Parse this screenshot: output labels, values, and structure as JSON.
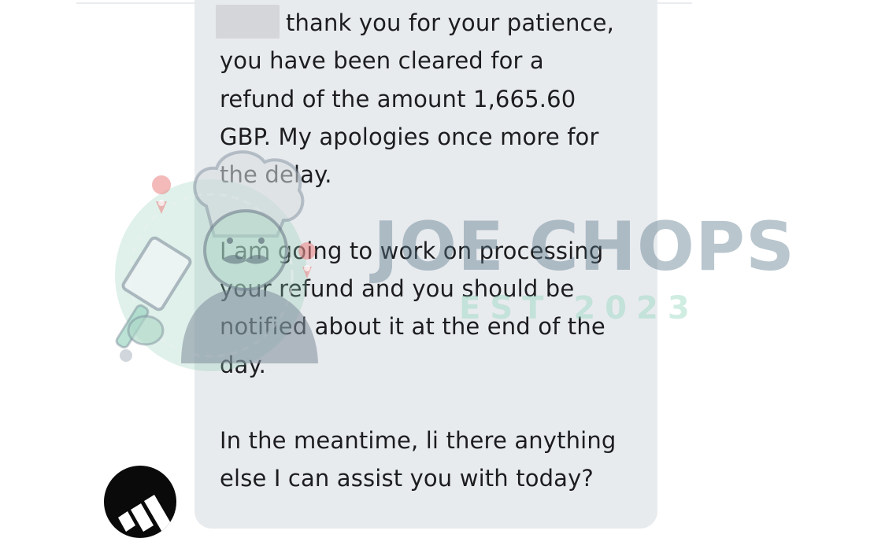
{
  "chat": {
    "agent_message": {
      "lines": [
        "thank you for your patience,",
        "you have been cleared for a",
        "refund of the amount 1,665.60",
        "GBP. My apologies once more for",
        "the delay.",
        "I am going to work on processing",
        "your refund and you should be",
        "notified about it at the end of the",
        "day.",
        "In the meantime, li there anything",
        "else I can assist you with today?"
      ]
    },
    "avatar_icon": "adidas-logo-icon"
  },
  "watermark": {
    "title": "JOE CHOPS",
    "subtitle": "EST 2023",
    "icon": "chef-mascot-icon"
  },
  "colors": {
    "bubble": "#e8ebee",
    "text": "#1d1d1f",
    "watermark_title": "#58768a",
    "watermark_sub": "#96d7be"
  }
}
